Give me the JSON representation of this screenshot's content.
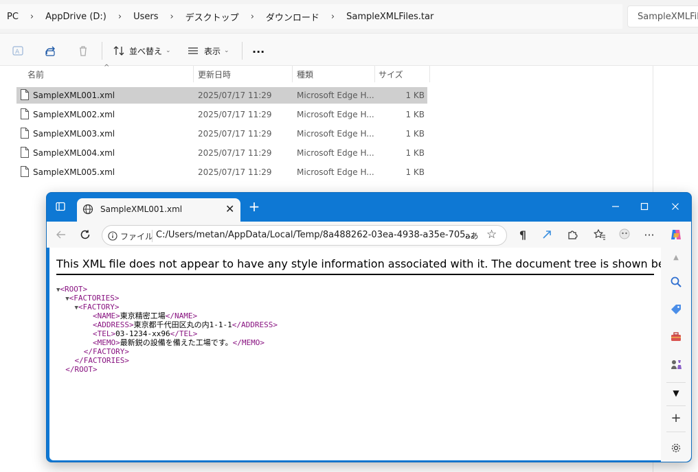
{
  "explorer": {
    "breadcrumbs": [
      "PC",
      "AppDrive (D:)",
      "Users",
      "デスクトップ",
      "ダウンロード",
      "SampleXMLFiles.tar"
    ],
    "search_placeholder": "SampleXMLFiles.tar",
    "toolbar": {
      "sort_label": "並べ替え",
      "view_label": "表示",
      "more_label": "..."
    },
    "columns": {
      "name": "名前",
      "modified": "更新日時",
      "type": "種類",
      "size": "サイズ"
    },
    "files": [
      {
        "name": "SampleXML001.xml",
        "modified": "2025/07/17 11:29",
        "type": "Microsoft Edge H...",
        "size": "1 KB",
        "selected": true
      },
      {
        "name": "SampleXML002.xml",
        "modified": "2025/07/17 11:29",
        "type": "Microsoft Edge H...",
        "size": "1 KB",
        "selected": false
      },
      {
        "name": "SampleXML003.xml",
        "modified": "2025/07/17 11:29",
        "type": "Microsoft Edge H...",
        "size": "1 KB",
        "selected": false
      },
      {
        "name": "SampleXML004.xml",
        "modified": "2025/07/17 11:29",
        "type": "Microsoft Edge H...",
        "size": "1 KB",
        "selected": false
      },
      {
        "name": "SampleXML005.xml",
        "modified": "2025/07/17 11:29",
        "type": "Microsoft Edge H...",
        "size": "1 KB",
        "selected": false
      }
    ]
  },
  "browser": {
    "tab_title": "SampleXML001.xml",
    "url_info_label": "ファイル",
    "url": "C:/Users/metan/AppData/Local/Temp/8a488262-03ea-4938-a35e-705...",
    "read_aloud_label": "aあ",
    "notice": "This XML file does not appear to have any style information associated with it. The document tree is shown below.",
    "xml": {
      "root_open": "<ROOT>",
      "factories_open": "<FACTORIES>",
      "factory_open": "<FACTORY>",
      "name_open": "<NAME>",
      "name_value": "東京精密工場",
      "name_close": "</NAME>",
      "address_open": "<ADDRESS>",
      "address_value": "東京都千代田区丸の内1-1-1",
      "address_close": "</ADDRESS>",
      "tel_open": "<TEL>",
      "tel_value": "03-1234-xx96",
      "tel_close": "</TEL>",
      "memo_open": "<MEMO>",
      "memo_value": "最新鋭の設備を備えた工場です。",
      "memo_close": "</MEMO>",
      "factory_close": "</FACTORY>",
      "factories_close": "</FACTORIES>",
      "root_close": "</ROOT>"
    }
  },
  "colors": {
    "edge_accent": "#0e78d4",
    "xml_tag": "#881280",
    "selected_row": "#cfcfcf"
  }
}
